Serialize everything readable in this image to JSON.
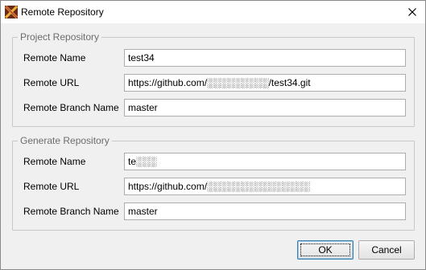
{
  "window": {
    "title": "Remote Repository",
    "icon": "app-logo-icon",
    "close_icon": "close-icon"
  },
  "project_group": {
    "legend": "Project Repository",
    "fields": [
      {
        "label": "Remote Name",
        "value": "test34"
      },
      {
        "label": "Remote URL",
        "value": "https://github.com/░░░░░░░░░/test34.git"
      },
      {
        "label": "Remote Branch Name",
        "value": "master"
      }
    ]
  },
  "generate_group": {
    "legend": "Generate Repository",
    "fields": [
      {
        "label": "Remote Name",
        "value": "te░░░"
      },
      {
        "label": "Remote URL",
        "value": "https://github.com/░░░░░░░░░░░░░░░"
      },
      {
        "label": "Remote Branch Name",
        "value": "master"
      }
    ]
  },
  "buttons": {
    "ok": "OK",
    "cancel": "Cancel"
  }
}
